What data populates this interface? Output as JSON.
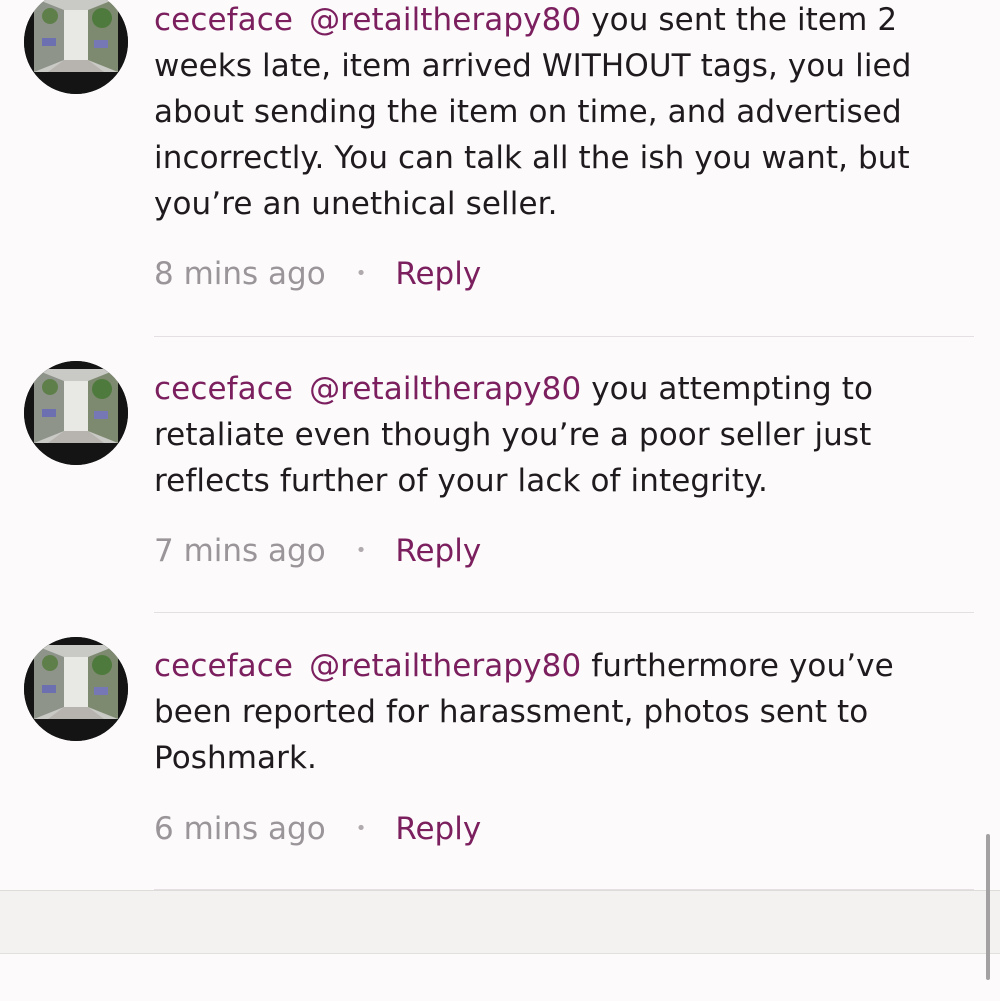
{
  "comments": [
    {
      "username": "ceceface",
      "mention": "@retailtherapy80",
      "body": " you sent the item 2 weeks late, item arrived WITHOUT tags, you lied about sending the item on time, and advertised incorrectly. You can talk all the ish you want, but you’re an unethical seller.",
      "time": "8 mins ago",
      "separator": "•",
      "reply_label": "Reply"
    },
    {
      "username": "ceceface",
      "mention": "@retailtherapy80",
      "body": " you attempting to retaliate even though you’re a poor seller just reflects further of your lack of integrity.",
      "time": "7 mins ago",
      "separator": "•",
      "reply_label": "Reply"
    },
    {
      "username": "ceceface",
      "mention": "@retailtherapy80",
      "body": " furthermore you’ve been reported for harassment, photos sent to Poshmark.",
      "time": "6 mins ago",
      "separator": "•",
      "reply_label": "Reply"
    }
  ],
  "colors": {
    "accent": "#7b1f5e",
    "text": "#1e1a1d",
    "muted": "#9a9599",
    "background": "#fcfafb",
    "divider": "#e3dfe2"
  },
  "icons": {
    "avatar": "avatar-street-photo"
  }
}
